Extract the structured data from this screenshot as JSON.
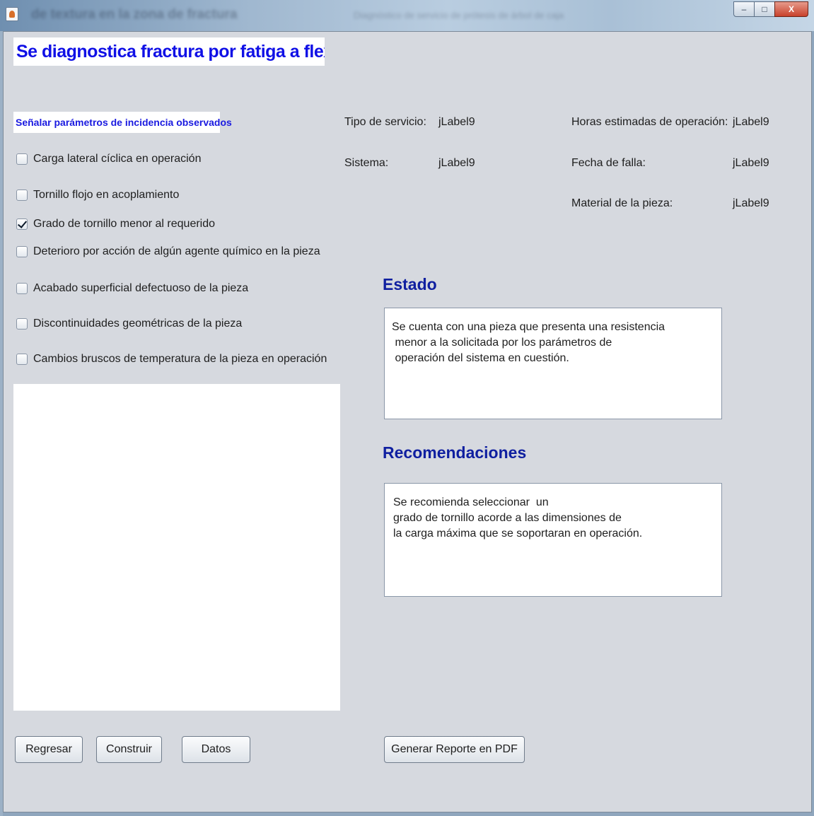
{
  "window": {
    "title": "de textura en la zona de fractura",
    "subtitle": "Diagnóstico de servicio de prótesis de árbol de caja",
    "controls": {
      "minimize": "–",
      "maximize": "□",
      "close": "X"
    }
  },
  "header": {
    "title": "Se diagnostica fractura  por fatiga a flexión"
  },
  "parameters": {
    "label": "Señalar parámetros de incidencia observados",
    "items": [
      {
        "label": "Carga lateral cíclica en operación",
        "checked": false
      },
      {
        "label": "Tornillo flojo en acoplamiento",
        "checked": false
      },
      {
        "label": "Grado de tornillo menor al requerido",
        "checked": true
      },
      {
        "label": "Deterioro por acción de algún agente químico en la pieza",
        "checked": false
      },
      {
        "label": "Acabado superficial defectuoso de la pieza",
        "checked": false
      },
      {
        "label": "Discontinuidades geométricas de la pieza",
        "checked": false
      },
      {
        "label": "Cambios bruscos de temperatura de la pieza en operación",
        "checked": false
      }
    ]
  },
  "info": {
    "tipo_servicio_label": "Tipo de servicio:",
    "tipo_servicio_value": "jLabel9",
    "sistema_label": "Sistema:",
    "sistema_value": "jLabel9",
    "horas_label": "Horas estimadas de operación:",
    "horas_value": "jLabel9",
    "fecha_label": "Fecha de falla:",
    "fecha_value": "jLabel9",
    "material_label": "Material de la pieza:",
    "material_value": "jLabel9"
  },
  "estado": {
    "heading": "Estado",
    "lines": [
      "Se cuenta con una pieza que presenta una resistencia",
      " menor a la solicitada por los parámetros de",
      " operación del sistema en cuestión."
    ]
  },
  "recomendaciones": {
    "heading": "Recomendaciones",
    "lines": [
      "Se recomienda seleccionar  un",
      "grado de tornillo acorde a las dimensiones de",
      "la carga máxima que se soportaran en operación."
    ]
  },
  "buttons": {
    "regresar": "Regresar",
    "construir": "Construir",
    "datos": "Datos",
    "pdf": "Generar Reporte en PDF"
  }
}
